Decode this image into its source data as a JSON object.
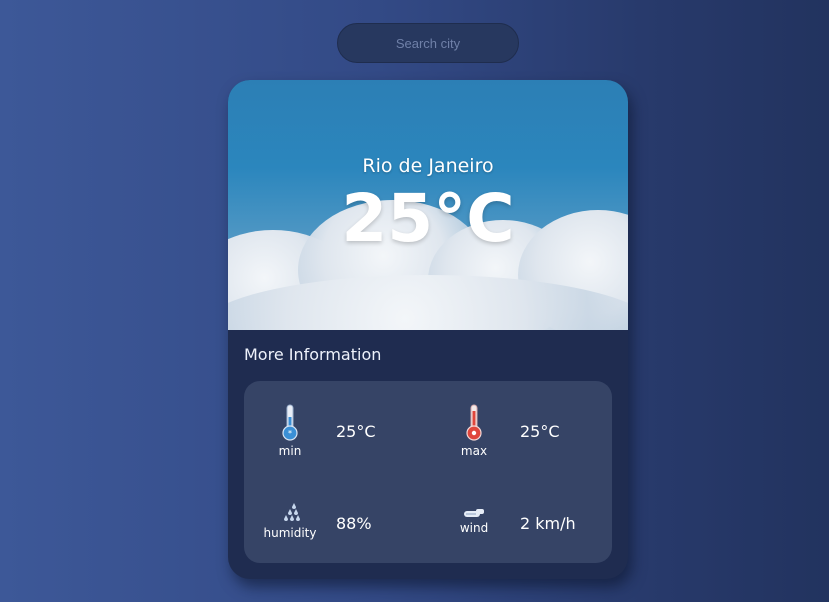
{
  "search": {
    "placeholder": "Search city"
  },
  "weather": {
    "city": "Rio de Janeiro",
    "temperature": "25°C"
  },
  "more_info": {
    "title": "More Information",
    "min": {
      "label": "min",
      "value": "25°C",
      "icon": "thermometer-cold-icon"
    },
    "max": {
      "label": "max",
      "value": "25°C",
      "icon": "thermometer-hot-icon"
    },
    "humidity": {
      "label": "humidity",
      "value": "88%",
      "icon": "raindrops-icon"
    },
    "wind": {
      "label": "wind",
      "value": "2 km/h",
      "icon": "wind-icon"
    }
  },
  "colors": {
    "background": "#334a86",
    "card": "#1f2c50",
    "info_box": "#364466",
    "min_accent": "#3a8fd6",
    "max_accent": "#e0463c"
  }
}
